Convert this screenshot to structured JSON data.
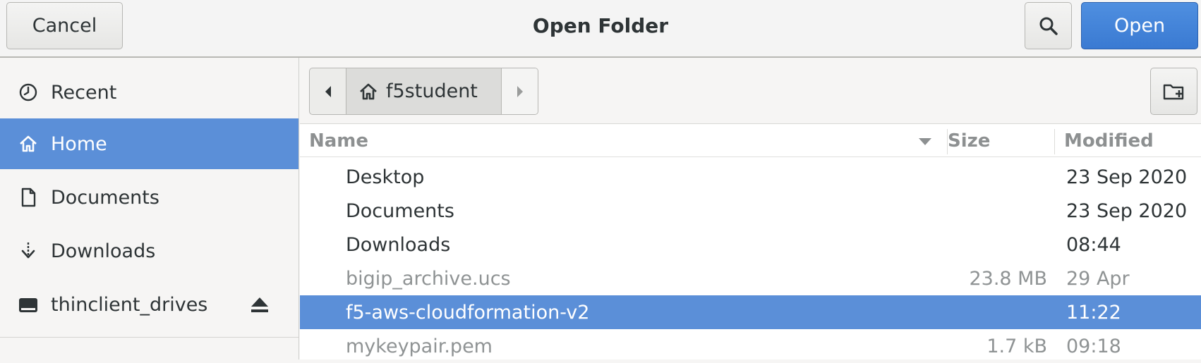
{
  "dialog": {
    "title": "Open Folder",
    "cancel_label": "Cancel",
    "open_label": "Open",
    "search_icon": "search-icon"
  },
  "sidebar": {
    "items": [
      {
        "label": "Recent",
        "icon": "clock-icon"
      },
      {
        "label": "Home",
        "icon": "home-icon",
        "selected": true
      },
      {
        "label": "Documents",
        "icon": "document-icon"
      },
      {
        "label": "Downloads",
        "icon": "download-icon"
      },
      {
        "label": "thinclient_drives",
        "icon": "drive-icon",
        "eject_icon": "eject-icon"
      }
    ]
  },
  "pathbar": {
    "current": "f5student",
    "home_icon": "home-icon",
    "back_icon": "chevron-left-icon",
    "forward_icon": "chevron-right-icon",
    "new_folder_icon": "new-folder-icon"
  },
  "columns": {
    "name": "Name",
    "size": "Size",
    "modified": "Modified"
  },
  "files": [
    {
      "name": "Desktop",
      "size": "",
      "modified": "23 Sep 2020"
    },
    {
      "name": "Documents",
      "size": "",
      "modified": "23 Sep 2020"
    },
    {
      "name": "Downloads",
      "size": "",
      "modified": "08:44"
    },
    {
      "name": "bigip_archive.ucs",
      "size": "23.8 MB",
      "modified": "29 Apr",
      "dim": true
    },
    {
      "name": "f5-aws-cloudformation-v2",
      "size": "",
      "modified": "11:22",
      "selected": true
    },
    {
      "name": "mykeypair.pem",
      "size": "1.7 kB",
      "modified": "09:18",
      "dim": true
    }
  ],
  "colors": {
    "accent": "#5b8fd8",
    "open_button": "#3a7ad2"
  }
}
